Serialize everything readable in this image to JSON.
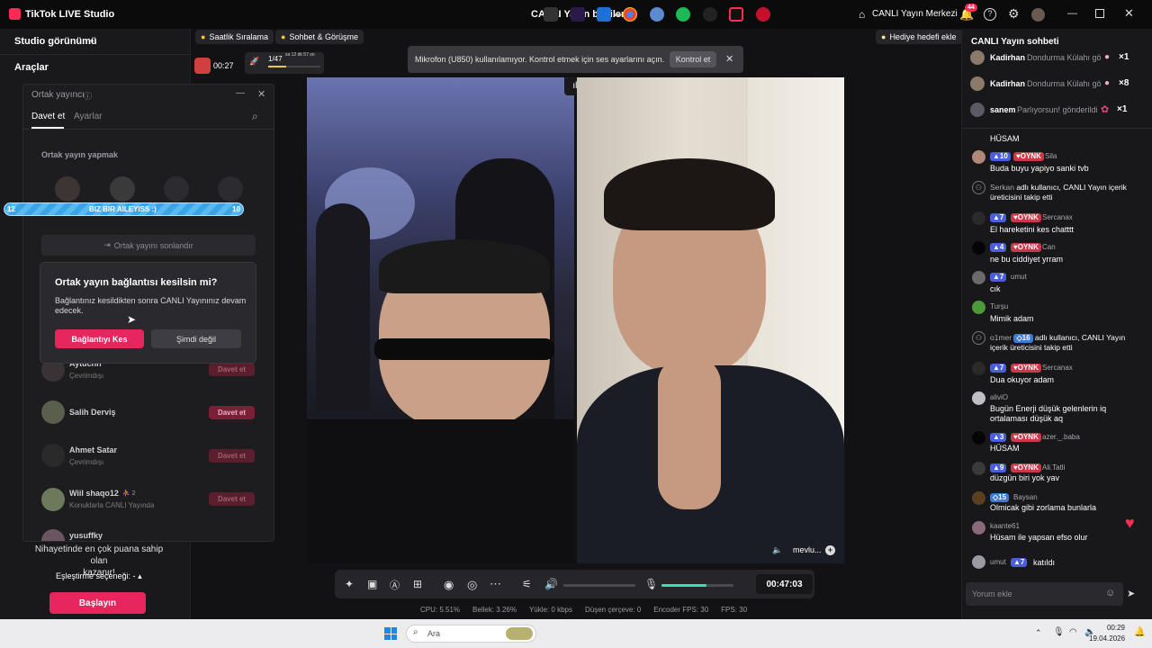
{
  "app": {
    "title": "TikTok LIVE Studio",
    "live_info": "CANLI Yayın bilgileri",
    "live_center": "CANLI Yayın Merkezi",
    "notif_count": "44"
  },
  "sidebar": {
    "studio_view": "Studio görünümü",
    "tools": "Araçlar",
    "match_text_1": "Nihayetinde en çok puana sahip olan",
    "match_text_2": "kazanır!",
    "match_option": "Eşleştirme seçeneği: -",
    "start_btn": "Başlayın"
  },
  "topbar": {
    "hourly_rank": "Saatlik Sıralama",
    "chat_meet": "Sohbet & Görüşme",
    "gift_goal": "Hediye hedefi ekle",
    "timer": "00:27",
    "progress": "1/47",
    "progress_note": "sa 12 dk 57 sn",
    "progress_pct": 35
  },
  "notice": {
    "text": "Mikrofon (U850) kullanılamıyor. Kontrol etmek için ses ayarlarını açın.",
    "button": "Kontrol et"
  },
  "cohost": {
    "title": "Ortak yayıncı",
    "tab_invite": "Davet et",
    "tab_settings": "Ayarlar",
    "section": "Ortak yayın yapmak",
    "battle_left": "12",
    "battle_label": "BIZ BIR AILEYISS :)",
    "battle_right": "10",
    "end_btn": "Ortak yayını sonlandır",
    "users": [
      {
        "name": "Aytuchh",
        "status": "Çevrimdışı",
        "action": "Davet et"
      },
      {
        "name": "Salih Derviş",
        "status": "",
        "action": "Davet et"
      },
      {
        "name": "Ahmet Satar",
        "status": "Çevrimdışı",
        "action": "Davet et"
      },
      {
        "name": "Wiil shaqo12",
        "badge": "2",
        "status": "Konuklarla CANLI Yayında",
        "action": "Davet et"
      },
      {
        "name": "yusuffky",
        "status": "",
        "action": ""
      }
    ]
  },
  "confirm": {
    "title": "Ortak yayın bağlantısı kesilsin mi?",
    "body": "Bağlantınız kesildikten sonra CANLI Yayınınız devam edecek.",
    "disconnect": "Bağlantıyı Kes",
    "cancel": "Şimdi değil"
  },
  "video": {
    "guest_name": "mevlu..."
  },
  "controls": {
    "elapsed": "00:47:03",
    "mic_level": 0.62
  },
  "status": {
    "cpu": "CPU: 5.51%",
    "memory": "Bellek: 3.26%",
    "upload": "Yükle: 0 kbps",
    "dropped": "Düşen çerçeve: 0",
    "encoder": "Encoder FPS: 30",
    "fps": "FPS: 30"
  },
  "chat": {
    "title": "CANLI Yayın sohbeti",
    "gifts": [
      {
        "user": "Kadirhan",
        "text": "Dondurma Külahı gö",
        "count": "×1"
      },
      {
        "user": "Kadirhan",
        "text": "Dondurma Külahı gö",
        "count": "×8"
      },
      {
        "user": "sanem",
        "text": "Parlıyorsun! gönderildi",
        "count": "×1"
      }
    ],
    "messages": [
      {
        "user": "",
        "lvl": "",
        "club": "",
        "text": "HÜSAM"
      },
      {
        "user": "Sila",
        "lvl": "10",
        "club": "OYNK",
        "text": "Buda buyu yapiyo sanki tvb"
      },
      {
        "user": "Serkan",
        "lvl": "",
        "club": "",
        "text": "adlı kullanıcı, CANLI Yayın içerik üreticisini takip etti"
      },
      {
        "user": "Sercanax",
        "lvl": "7",
        "club": "OYNK",
        "text": "El hareketini kes chatttt"
      },
      {
        "user": "Can",
        "lvl": "4",
        "club": "OYNK",
        "text": "ne bu ciddiyet yrram"
      },
      {
        "user": "umut",
        "lvl": "7",
        "club": "",
        "text": "cık"
      },
      {
        "user": "Turşu",
        "lvl": "",
        "club": "",
        "text": "Mimik adam"
      },
      {
        "user": "o1mer",
        "lvl": "16",
        "club": "",
        "text": "adlı kullanıcı, CANLI Yayın içerik üreticisini takip etti"
      },
      {
        "user": "Sercanax",
        "lvl": "7",
        "club": "OYNK",
        "text": "Dua okuyor adam"
      },
      {
        "user": "aliviO",
        "lvl": "",
        "club": "",
        "text": "Bugün Enerji düşük gelenlerin iq ortalaması düşük aq"
      },
      {
        "user": "azer._.baba",
        "lvl": "3",
        "club": "OYNK",
        "text": "HÜSAM"
      },
      {
        "user": "Ali.Tatli",
        "lvl": "9",
        "club": "OYNK",
        "text": "düzgün biri yok yav"
      },
      {
        "user": "Baysan",
        "lvl": "15",
        "club": "",
        "text": "Olmicak gibi zorlama bunlarla"
      },
      {
        "user": "kaante61",
        "lvl": "",
        "club": "",
        "text": "Hüsam ile yapsan efso olur"
      },
      {
        "user": "umut",
        "lvl": "7",
        "club": "",
        "text": "katıldı"
      }
    ],
    "input_placeholder": "Yorum ekle"
  },
  "taskbar": {
    "search": "Ara",
    "time": "00:29",
    "date": "19.04.2026"
  }
}
